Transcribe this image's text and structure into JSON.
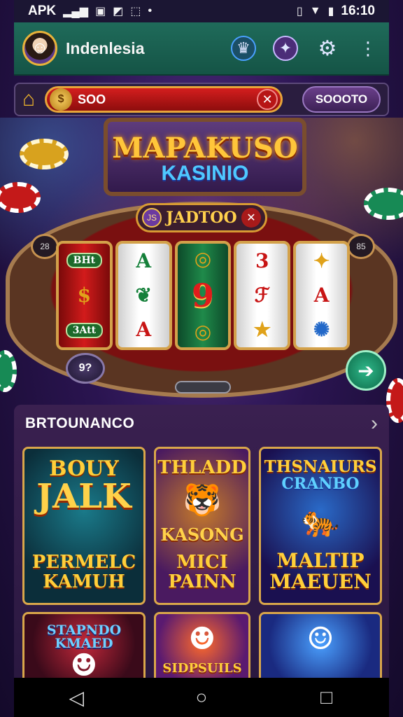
{
  "status_bar": {
    "carrier": "APK",
    "time": "16:10",
    "left_icons": [
      "signal-icon",
      "sim-icon",
      "no-signal-icon",
      "chart-icon",
      "dot-icon"
    ],
    "right_icons": [
      "vibrate-icon",
      "wifi-icon",
      "battery-icon"
    ]
  },
  "header": {
    "username": "Indenlesia",
    "icons": [
      "trophy-icon",
      "target-icon",
      "settings-icon",
      "more-icon"
    ]
  },
  "balance_bar": {
    "balance_value": "SOO",
    "button_label": "SOOOTO"
  },
  "machine": {
    "title": "MAPAKUSO",
    "subtitle": "KASINIO",
    "jackpot_value": "JADTOO",
    "jackpot_badge": "JS",
    "left_badge": "28",
    "right_badge": "85",
    "bet_knob_label": "9?",
    "reels": [
      {
        "symbols": [
          "BHt",
          "$",
          "3Att"
        ]
      },
      {
        "symbols": [
          "A",
          "❦",
          "A"
        ]
      },
      {
        "symbols": [
          "◎",
          "9",
          "◎"
        ]
      },
      {
        "symbols": [
          "3",
          "ℱ",
          "★"
        ]
      },
      {
        "symbols": [
          "✦",
          "A",
          "✺"
        ]
      }
    ]
  },
  "games_panel": {
    "title": "BRTOUNANCO",
    "games": [
      {
        "top": "BOUY",
        "big": "JALK",
        "bottom_1": "PERMELC",
        "bottom_2": "KAMUH"
      },
      {
        "top": "THLADD",
        "mid": "KASONG",
        "bottom_1": "MICI",
        "bottom_2": "PAINN"
      },
      {
        "top": "THSNAIURS",
        "mid": "CRANBO",
        "bottom_1": "MALTIP",
        "bottom_2": "MAEUEN"
      },
      {
        "top": "STAPNDO KMAED"
      },
      {
        "bottom_1": "SIDPSUILS"
      },
      {}
    ]
  },
  "colors": {
    "header_bg": "#1f6b5a",
    "accent_gold": "#ffcf3a",
    "balance_red": "#d41e1e",
    "spin_green": "#2fb88a"
  }
}
